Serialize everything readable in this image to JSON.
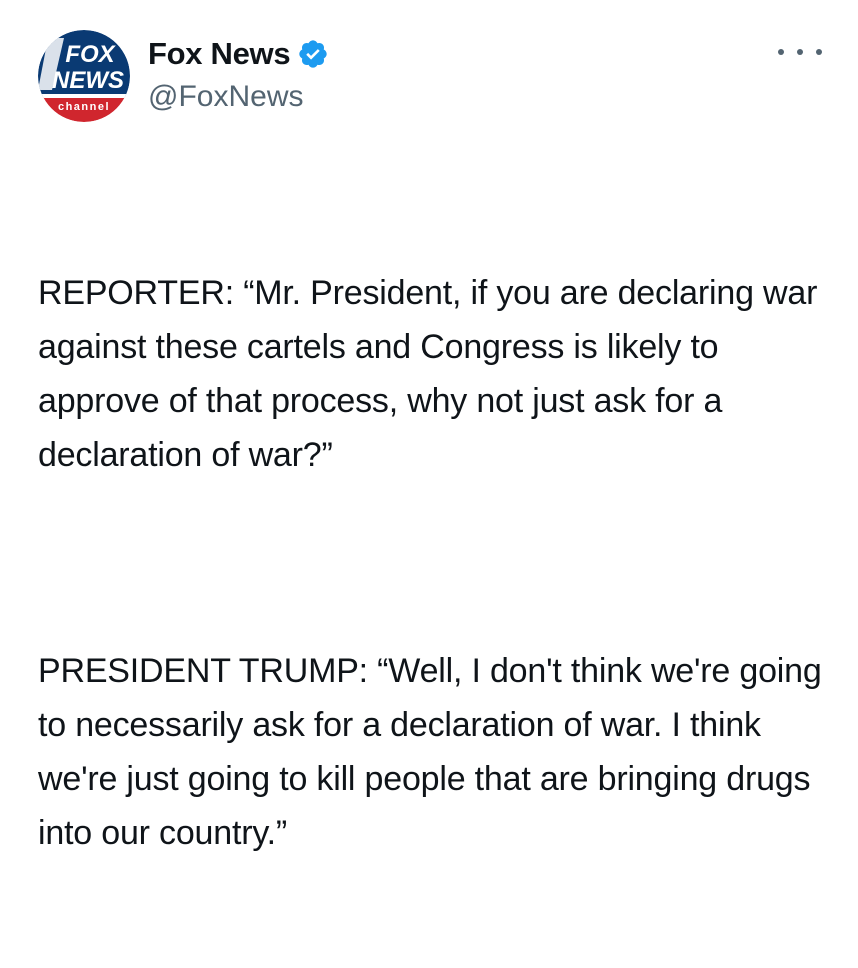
{
  "tweet": {
    "author": {
      "display_name": "Fox News",
      "handle": "@FoxNews",
      "verified_icon": "verified-badge-icon",
      "verified_color": "#1d9bf0",
      "avatar": {
        "logo_text_top": "FOX",
        "logo_text_bottom": "NEWS",
        "logo_subtext": "channel",
        "brand_blue": "#003366",
        "brand_red": "#d0262e"
      }
    },
    "more_menu_icon": "more-horizontal-icon",
    "paragraphs": [
      "REPORTER: “Mr. President, if you are declaring war against these cartels and Congress is likely to approve of that process, why not just ask for a declaration of war?”",
      "PRESIDENT TRUMP: “Well, I don't think we're going to necessarily ask for a declaration of war. I think we're just going to kill people that are bringing drugs into our country.”"
    ]
  }
}
